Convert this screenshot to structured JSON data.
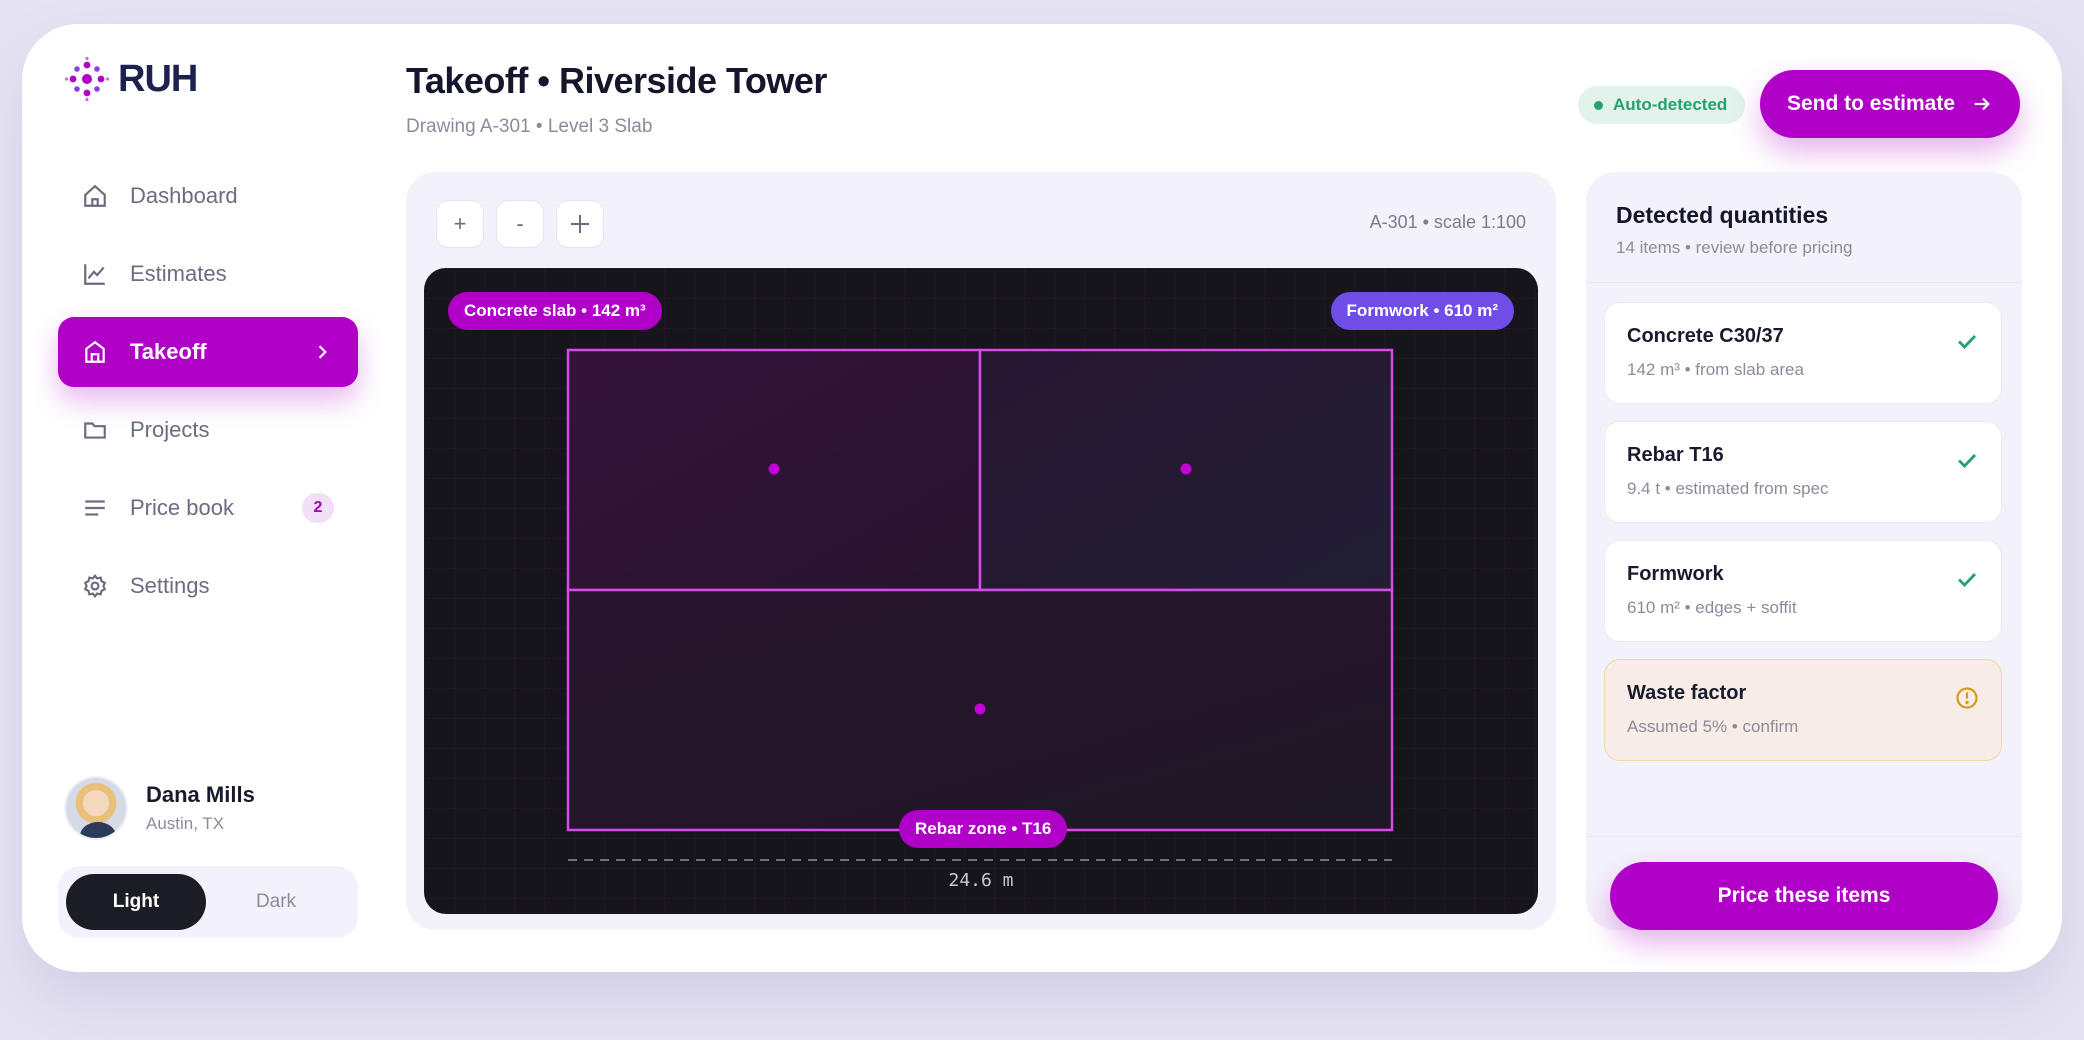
{
  "app": {
    "logo_text": "RUH"
  },
  "sidebar": {
    "items": [
      {
        "label": "Dashboard",
        "icon": "home-icon"
      },
      {
        "label": "Estimates",
        "icon": "chart-icon"
      },
      {
        "label": "Takeoff",
        "icon": "building-icon",
        "active": true
      },
      {
        "label": "Projects",
        "icon": "folder-icon"
      },
      {
        "label": "Price book",
        "icon": "list-icon",
        "badge": "2"
      },
      {
        "label": "Settings",
        "icon": "gear-icon"
      }
    ]
  },
  "user": {
    "name": "Dana Mills",
    "location": "Austin, TX"
  },
  "theme": {
    "light_label": "Light",
    "dark_label": "Dark",
    "selected": "Light"
  },
  "header": {
    "title": "Takeoff • Riverside Tower",
    "subtitle": "Drawing A-301 • Level 3 Slab",
    "status_badge": "Auto-detected",
    "primary_action": "Send to estimate"
  },
  "canvas": {
    "toolbar": {
      "zoom_in": "+",
      "zoom_out": "-",
      "pan": "+"
    },
    "sheet_label": "A-301 • scale 1:100",
    "tags": {
      "concrete": "Concrete slab • 142 m³",
      "formwork": "Formwork • 610 m²",
      "rebar": "Rebar zone • T16"
    },
    "dimension_label": "24.6 m"
  },
  "quantities": {
    "title": "Detected quantities",
    "subtitle": "14 items • review before pricing",
    "items": [
      {
        "name": "Concrete C30/37",
        "detail": "142 m³ • from slab area",
        "status": "confirmed"
      },
      {
        "name": "Rebar T16",
        "detail": "9.4 t • estimated from spec",
        "status": "confirmed"
      },
      {
        "name": "Formwork",
        "detail": "610 m² • edges + soffit",
        "status": "confirmed"
      },
      {
        "name": "Waste factor",
        "detail": "Assumed 5% • confirm",
        "status": "needs-review"
      }
    ],
    "action": "Price these items"
  },
  "colors": {
    "accent": "#b000c8",
    "accent_violet": "#6f4ee8",
    "success": "#23a36b",
    "warning": "#d99a1c",
    "canvas_bg": "#16151c"
  }
}
